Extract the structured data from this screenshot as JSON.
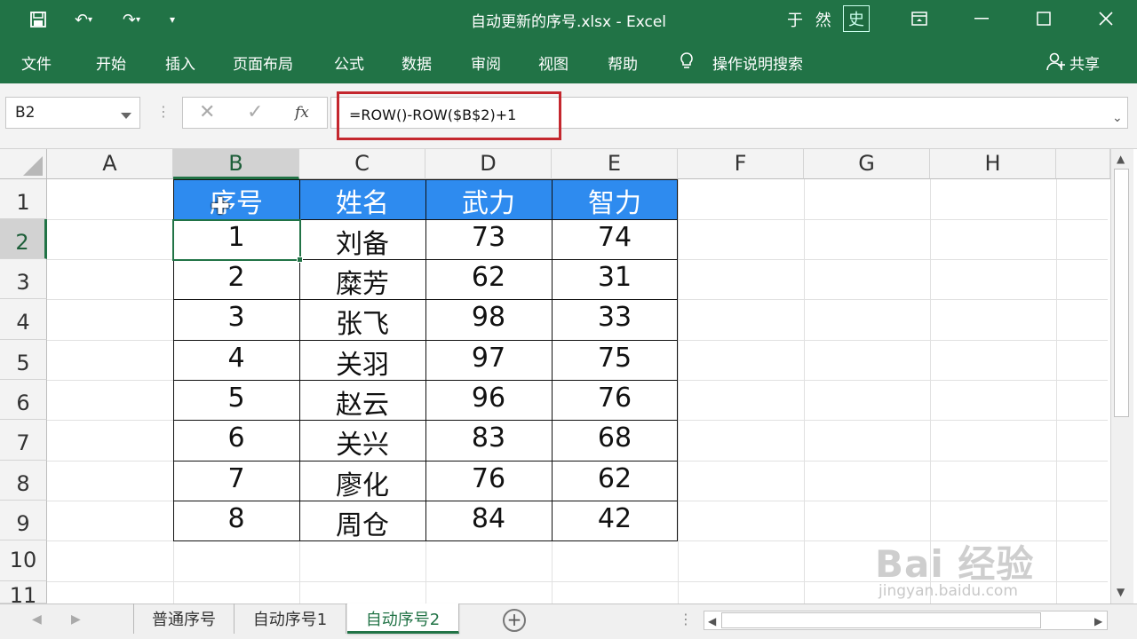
{
  "window": {
    "title": "自动更新的序号.xlsx  -  Excel",
    "user": "于 然",
    "user_badge": "史",
    "quick_access": {
      "save_icon": "save-icon",
      "undo_icon": "undo-icon",
      "redo_icon": "redo-icon",
      "customize_icon": "customize-icon"
    }
  },
  "ribbon": {
    "tabs": [
      "文件",
      "开始",
      "插入",
      "页面布局",
      "公式",
      "数据",
      "审阅",
      "视图",
      "帮助"
    ],
    "tell_me": "操作说明搜索",
    "share": "共享"
  },
  "formula_bar": {
    "name_box": "B2",
    "formula": "=ROW()-ROW($B$2)+1",
    "fx": "fx"
  },
  "grid": {
    "columns": [
      "A",
      "B",
      "C",
      "D",
      "E",
      "F",
      "G",
      "H"
    ],
    "rows": [
      "1",
      "2",
      "3",
      "4",
      "5",
      "6",
      "7",
      "8",
      "9",
      "10",
      "11"
    ],
    "selected_column": "B",
    "selected_row": "2"
  },
  "table": {
    "headers": [
      "序号",
      "姓名",
      "武力",
      "智力"
    ],
    "rows": [
      [
        "1",
        "刘备",
        "73",
        "74"
      ],
      [
        "2",
        "糜芳",
        "62",
        "31"
      ],
      [
        "3",
        "张飞",
        "98",
        "33"
      ],
      [
        "4",
        "关羽",
        "97",
        "75"
      ],
      [
        "5",
        "赵云",
        "96",
        "76"
      ],
      [
        "6",
        "关兴",
        "83",
        "68"
      ],
      [
        "7",
        "廖化",
        "76",
        "62"
      ],
      [
        "8",
        "周仓",
        "84",
        "42"
      ]
    ],
    "header_color": "#2e8bef"
  },
  "sheets": {
    "tabs": [
      "普通序号",
      "自动序号1",
      "自动序号2"
    ],
    "active": "自动序号2"
  },
  "watermark": {
    "main": "Bai 经验",
    "sub": "jingyan.baidu.com"
  },
  "colors": {
    "accent": "#217346",
    "highlight_border": "#c4272e"
  }
}
